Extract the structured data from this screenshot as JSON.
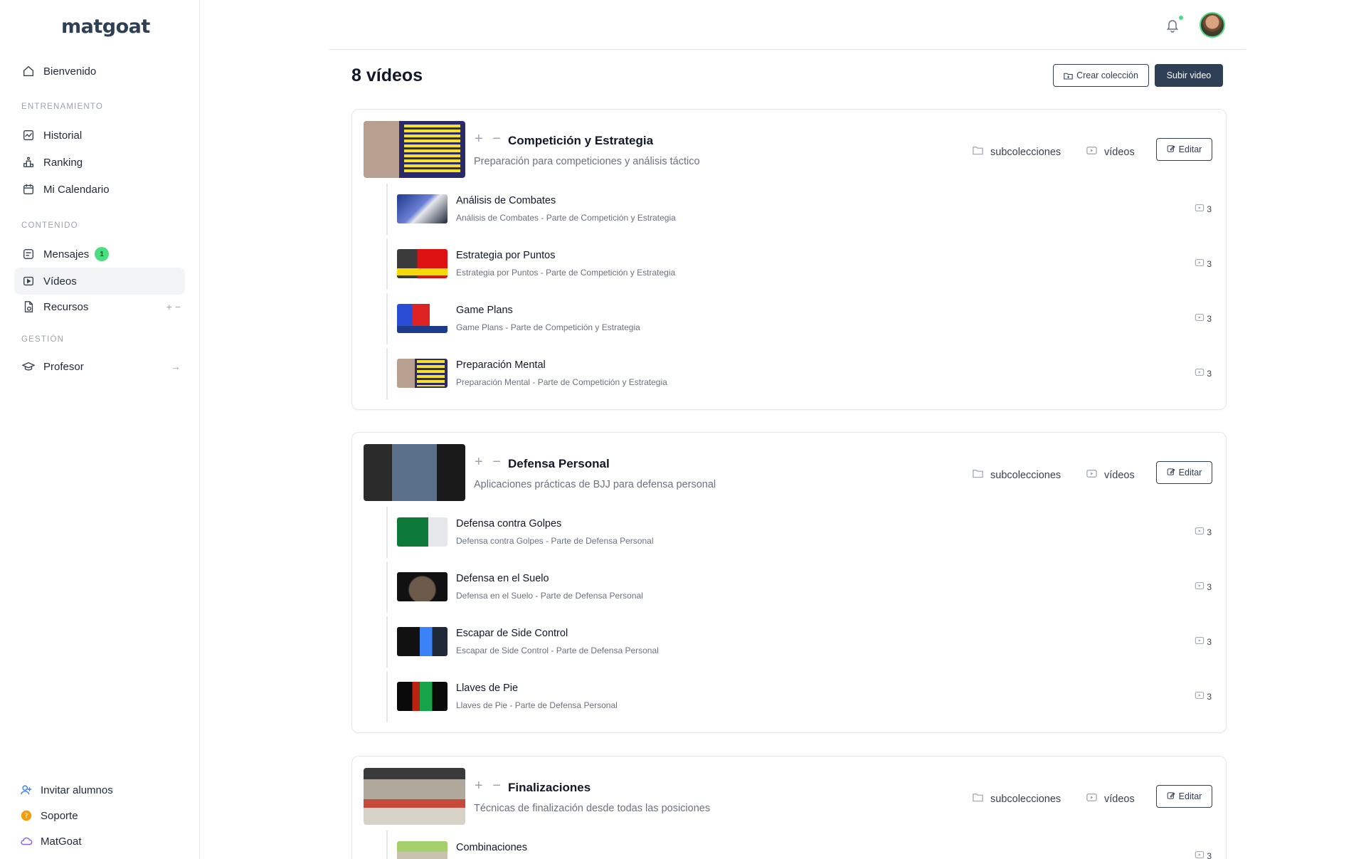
{
  "app": {
    "logo": "matgoat"
  },
  "sidebar": {
    "sections": {
      "training": "ENTRENAMIENTO",
      "content": "CONTENIDO",
      "management": "GESTIÓN"
    },
    "items": {
      "welcome": "Bienvenido",
      "history": "Historial",
      "ranking": "Ranking",
      "calendar": "Mi Calendario",
      "messages": "Mensajes",
      "messages_badge": "1",
      "videos": "Vídeos",
      "resources": "Recursos",
      "resources_trail": "+ −",
      "teacher": "Profesor",
      "teacher_trail": "→"
    },
    "bottom": {
      "invite": "Invitar alumnos",
      "support": "Soporte",
      "matgoat": "MatGoat"
    }
  },
  "header": {
    "notification_icon": "bell-icon"
  },
  "page": {
    "title": "8 vídeos",
    "create_collection": "Crear colección",
    "upload_video": "Subir video"
  },
  "labels": {
    "subcollections": "subcolecciones",
    "videos": "vídeos",
    "edit": "Editar",
    "controls": "+ −"
  },
  "collections": [
    {
      "title": "Competición y Estrategia",
      "description": "Preparación para competiciones y análisis táctico",
      "subs": [
        {
          "title": "Análisis de Combates",
          "description": "Análisis de Combates - Parte de Competición y Estrategia",
          "count": "3"
        },
        {
          "title": "Estrategia por Puntos",
          "description": "Estrategia por Puntos - Parte de Competición y Estrategia",
          "count": "3"
        },
        {
          "title": "Game Plans",
          "description": "Game Plans - Parte de Competición y Estrategia",
          "count": "3"
        },
        {
          "title": "Preparación Mental",
          "description": "Preparación Mental - Parte de Competición y Estrategia",
          "count": "3"
        }
      ]
    },
    {
      "title": "Defensa Personal",
      "description": "Aplicaciones prácticas de BJJ para defensa personal",
      "subs": [
        {
          "title": "Defensa contra Golpes",
          "description": "Defensa contra Golpes - Parte de Defensa Personal",
          "count": "3"
        },
        {
          "title": "Defensa en el Suelo",
          "description": "Defensa en el Suelo - Parte de Defensa Personal",
          "count": "3"
        },
        {
          "title": "Escapar de Side Control",
          "description": "Escapar de Side Control - Parte de Defensa Personal",
          "count": "3"
        },
        {
          "title": "Llaves de Pie",
          "description": "Llaves de Pie - Parte de Defensa Personal",
          "count": "3"
        }
      ]
    },
    {
      "title": "Finalizaciones",
      "description": "Técnicas de finalización desde todas las posiciones",
      "subs": [
        {
          "title": "Combinaciones",
          "description": "",
          "count": "3"
        }
      ]
    }
  ],
  "colors": {
    "primary": "#2f4056",
    "accent": "#4ade80",
    "border": "#e5e7eb",
    "muted": "#6b7280"
  }
}
